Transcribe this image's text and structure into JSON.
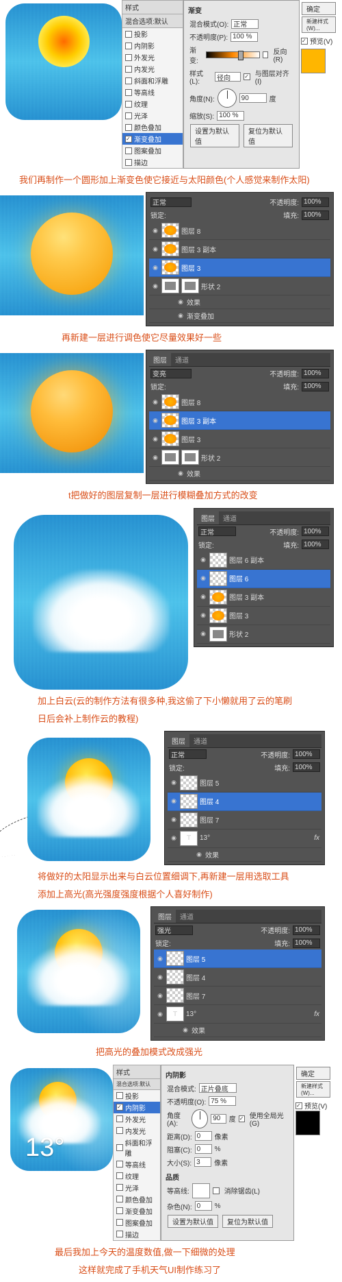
{
  "gradient_panel": {
    "title": "渐变",
    "blend_label": "混合模式(O):",
    "blend_value": "正常",
    "opacity_label": "不透明度(P):",
    "opacity_value": "100 %",
    "gradient_label": "渐变:",
    "reverse_label": "反向(R)",
    "style_label": "样式(L):",
    "style_value": "径向",
    "align_label": "与图层对齐(I)",
    "angle_label": "角度(N):",
    "angle_value": "90",
    "angle_unit": "度",
    "scale_label": "缩放(S):",
    "scale_value": "100 %",
    "default_btn": "设置为默认值",
    "reset_btn": "复位为默认值"
  },
  "styles_panel": {
    "header": "样式",
    "blend_header": "混合选项:默认",
    "items": [
      "投影",
      "内阴影",
      "外发光",
      "内发光",
      "斜面和浮雕",
      "等高线",
      "纹理",
      "光泽",
      "颜色叠加",
      "渐变叠加",
      "图案叠加",
      "描边"
    ],
    "selected_s1": "渐变叠加",
    "selected_s7": "内阴影"
  },
  "side_btns": {
    "ok": "确定",
    "new_style": "新建样式(W)...",
    "preview": "预览(V)"
  },
  "step1": "我们再制作一个圆形加上渐变色使它接近与太阳颜色(个人感觉来制作太阳)",
  "layers2": {
    "blend": "正常",
    "opacity_label": "不透明度:",
    "opacity": "100%",
    "lock": "锁定:",
    "fill_label": "填充:",
    "fill": "100%",
    "l1": "图层 8",
    "l2": "图层 3 副本",
    "l3": "图层 3",
    "l4": "形状 2",
    "fx": "效果",
    "fx1": "渐变叠加"
  },
  "step2": "再新建一层进行调色使它尽量效果好一些",
  "layers3": {
    "tab1": "图层",
    "tab2": "通道",
    "blend": "变亮",
    "opacity_label": "不透明度:",
    "opacity": "100%",
    "lock": "锁定:",
    "fill_label": "填充:",
    "fill": "100%",
    "l1": "图层 8",
    "l2": "图层 3 副本",
    "l3": "图层 3",
    "l4": "形状 2",
    "fx": "效果"
  },
  "step3": "t把做好的图层复制一层进行模糊叠加方式的改变",
  "layers4": {
    "tab1": "图层",
    "tab2": "通道",
    "blend": "正常",
    "opacity_label": "不透明度:",
    "opacity": "100%",
    "lock": "锁定:",
    "fill_label": "填充:",
    "fill": "100%",
    "l1": "图层 6 副本",
    "l2": "图层 6",
    "l3": "图层 3 副本",
    "l4": "图层 3",
    "l5": "形状 2"
  },
  "step4a": "加上白云(云的制作方法有很多种,我这偷了下小懒就用了云的笔刷",
  "step4b": "日后会补上制作云的教程)",
  "layers5": {
    "tab1": "图层",
    "tab2": "通道",
    "blend": "正常",
    "opacity_label": "不透明度:",
    "opacity": "100%",
    "lock": "锁定:",
    "fill_label": "填充:",
    "fill": "100%",
    "l1": "图层 5",
    "l2": "图层 4",
    "l3": "图层 7",
    "l4": "13°",
    "fx": "效果"
  },
  "step5a": "将做好的太阳显示出来与白云位置细调下,再新建一层用选取工具",
  "step5b": "添加上高光(高光强度强度根据个人喜好制作)",
  "layers6": {
    "tab1": "图层",
    "tab2": "通道",
    "blend": "强光",
    "opacity_label": "不透明度:",
    "opacity": "100%",
    "lock": "锁定:",
    "fill_label": "填充:",
    "fill": "100%",
    "l1": "图层 5",
    "l2": "图层 4",
    "l3": "图层 7",
    "l4": "13°",
    "fx": "效果"
  },
  "step6": "把高光的叠加模式改成强光",
  "inner_shadow": {
    "title": "内阴影",
    "blend_label": "混合模式:",
    "blend_value": "正片叠底",
    "opacity_label": "不透明度(O):",
    "opacity_value": "75 %",
    "angle_label": "角度(A):",
    "angle_value": "90",
    "angle_unit": "度",
    "global": "使用全局光(G)",
    "distance_label": "距离(D):",
    "distance_value": "0",
    "distance_unit": "像素",
    "choke_label": "阻塞(C):",
    "choke_value": "0",
    "choke_unit": "%",
    "size_label": "大小(S):",
    "size_value": "3",
    "size_unit": "像素",
    "quality": "品质",
    "contour_label": "等高线:",
    "anti": "消除锯齿(L)",
    "noise_label": "杂色(N):",
    "noise_value": "0",
    "noise_unit": "%",
    "default_btn": "设置为默认值",
    "reset_btn": "复位为默认值"
  },
  "temp_value": "13°",
  "step7a": "最后我加上今天的温度数值,做一下细微的处理",
  "step7b": "这样就完成了手机天气UI制作练习了"
}
